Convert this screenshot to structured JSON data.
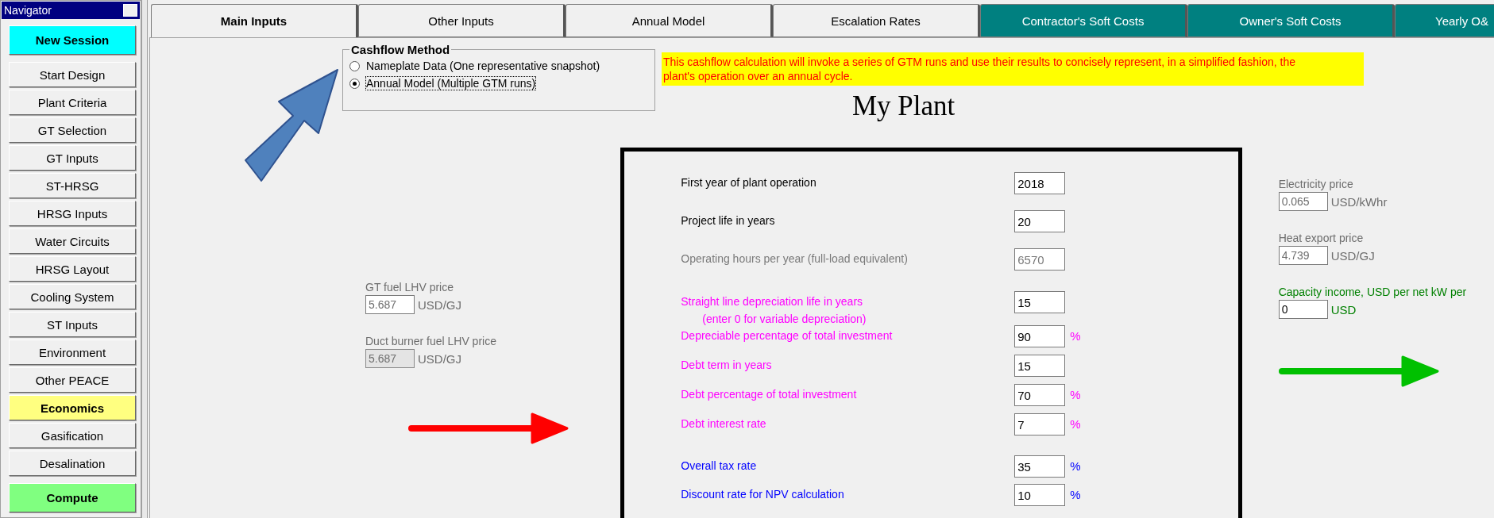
{
  "navigator": {
    "title": "Navigator",
    "items": [
      {
        "label": "New Session",
        "kind": "session",
        "selected": false
      },
      {
        "label": "Start Design",
        "kind": "page",
        "selected": false
      },
      {
        "label": "Plant Criteria",
        "kind": "page",
        "selected": false
      },
      {
        "label": "GT Selection",
        "kind": "page",
        "selected": false
      },
      {
        "label": "GT Inputs",
        "kind": "page",
        "selected": false
      },
      {
        "label": "ST-HRSG",
        "kind": "page",
        "selected": false
      },
      {
        "label": "HRSG Inputs",
        "kind": "page",
        "selected": false
      },
      {
        "label": "Water Circuits",
        "kind": "page",
        "selected": false
      },
      {
        "label": "HRSG Layout",
        "kind": "page",
        "selected": false
      },
      {
        "label": "Cooling System",
        "kind": "page",
        "selected": false
      },
      {
        "label": "ST Inputs",
        "kind": "page",
        "selected": false
      },
      {
        "label": "Environment",
        "kind": "page",
        "selected": false
      },
      {
        "label": "Other PEACE",
        "kind": "page",
        "selected": false
      },
      {
        "label": "Economics",
        "kind": "page",
        "selected": true
      },
      {
        "label": "Gasification",
        "kind": "page",
        "selected": false
      },
      {
        "label": "Desalination",
        "kind": "page",
        "selected": false
      },
      {
        "label": "Compute",
        "kind": "compute",
        "selected": false
      }
    ]
  },
  "tabs": [
    {
      "label": "Main Inputs",
      "selected": true,
      "color": "#f0f0f0"
    },
    {
      "label": "Other Inputs",
      "selected": false,
      "color": "#f0f0f0"
    },
    {
      "label": "Annual Model",
      "selected": false,
      "color": "#f0f0f0"
    },
    {
      "label": "Escalation Rates",
      "selected": false,
      "color": "#f0f0f0"
    },
    {
      "label": "Contractor's Soft Costs",
      "selected": false,
      "color": "#008080"
    },
    {
      "label": "Owner's Soft Costs",
      "selected": false,
      "color": "#008080"
    },
    {
      "label": "Yearly O&",
      "selected": false,
      "color": "#008080"
    }
  ],
  "cashflow_method": {
    "title": "Cashflow Method",
    "options": [
      {
        "label": "Nameplate Data (One representative snapshot)",
        "selected": false
      },
      {
        "label": "Annual Model (Multiple GTM runs)",
        "selected": true
      }
    ]
  },
  "notice": "This cashflow calculation will invoke a series of GTM runs and use their results to concisely represent, in a simplified fashion, the plant's operation over an annual cycle.",
  "plant_title": "My Plant",
  "fuel_prices": [
    {
      "label": "GT fuel LHV price",
      "value": "5.687",
      "unit": "USD/GJ",
      "kind": "computed",
      "disabled": false,
      "color": "#6d6d6d"
    },
    {
      "label": "Duct burner fuel LHV price",
      "value": "5.687",
      "unit": "USD/GJ",
      "kind": "computed",
      "disabled": true,
      "color": "#6d6d6d"
    }
  ],
  "parameters": [
    {
      "kind": "basic",
      "rows": [
        {
          "label": "First year of plant operation",
          "value": "2018",
          "disabled": false
        },
        {
          "label": "Project life in years",
          "value": "20",
          "disabled": false
        },
        {
          "label": "Operating hours per year (full-load equivalent)",
          "value": "6570",
          "disabled": true
        }
      ]
    },
    {
      "kind": "financing",
      "rows": [
        {
          "label": "Straight line depreciation life in years",
          "note": "(enter 0 for variable depreciation)",
          "value": "15",
          "disabled": false
        },
        {
          "label": "Depreciable percentage of total investment",
          "value": "90",
          "unit": "%",
          "disabled": false
        },
        {
          "label": "Debt term in years",
          "value": "15",
          "disabled": false
        },
        {
          "label": "Debt percentage of total investment",
          "value": "70",
          "unit": "%",
          "disabled": false
        },
        {
          "label": "Debt interest rate",
          "value": "7",
          "unit": "%",
          "disabled": false
        }
      ]
    },
    {
      "kind": "tax",
      "rows": [
        {
          "label": "Overall tax rate",
          "value": "35",
          "unit": "%",
          "disabled": false
        },
        {
          "label": "Discount rate for NPV calculation",
          "value": "10",
          "unit": "%",
          "disabled": false
        }
      ]
    }
  ],
  "revenue_prices": [
    {
      "label": "Electricity price",
      "value": "0.065",
      "unit": "USD/kWhr",
      "kind": "computed",
      "disabled": false,
      "color": "#6d6d6d"
    },
    {
      "label": "Heat export price",
      "value": "4.739",
      "unit": "USD/GJ",
      "kind": "computed",
      "disabled": false,
      "color": "#6d6d6d"
    },
    {
      "label": "Capacity income,  USD per net kW per",
      "value": "0",
      "unit": "USD",
      "kind": "input",
      "disabled": false,
      "color": "#008000"
    }
  ]
}
